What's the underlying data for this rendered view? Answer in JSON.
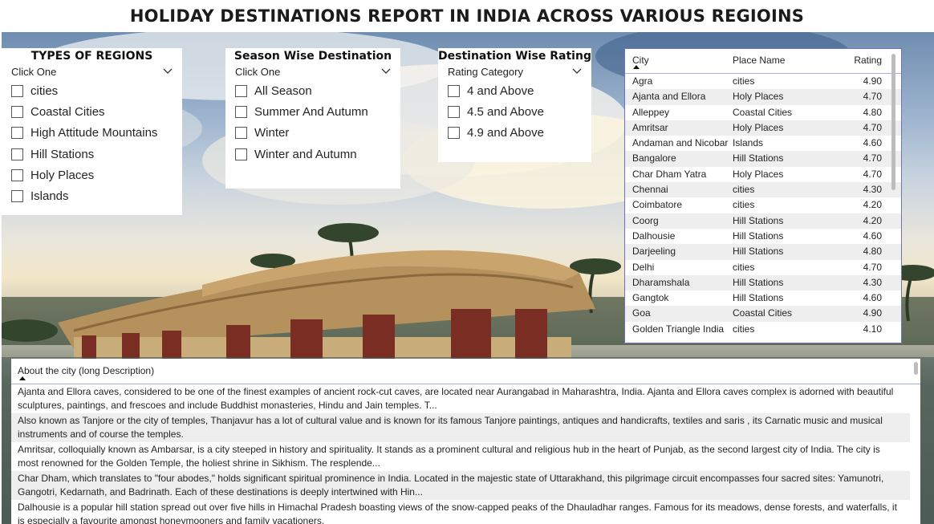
{
  "title": "HOLIDAY DESTINATIONS REPORT IN INDIA ACROSS VARIOUS REGIOINS",
  "regions_slicer": {
    "title": "TYPES OF REGIONS",
    "header": "Click One",
    "items": [
      "cities",
      "Coastal Cities",
      "High Attitude Mountains",
      "Hill Stations",
      "Holy Places",
      "Islands"
    ]
  },
  "season_slicer": {
    "title": "Season Wise Destination",
    "header": "Click One",
    "items": [
      "All Season",
      "Summer And Autumn",
      "Winter",
      "Winter and Autumn"
    ]
  },
  "rating_slicer": {
    "title": "Destination Wise Rating",
    "header": "Rating Category",
    "items": [
      "4 and Above",
      "4.5 and Above",
      "4.9 and Above"
    ]
  },
  "table": {
    "columns": [
      "City",
      "Place Name",
      "Rating"
    ],
    "rows": [
      [
        "Agra",
        "cities",
        "4.90"
      ],
      [
        "Ajanta and Ellora",
        "Holy Places",
        "4.70"
      ],
      [
        "Alleppey",
        "Coastal Cities",
        "4.80"
      ],
      [
        "Amritsar",
        "Holy Places",
        "4.70"
      ],
      [
        "Andaman and Nicobar",
        "Islands",
        "4.60"
      ],
      [
        "Bangalore",
        "Hill Stations",
        "4.70"
      ],
      [
        "Char Dham Yatra",
        "Holy Places",
        "4.70"
      ],
      [
        "Chennai",
        "cities",
        "4.30"
      ],
      [
        "Coimbatore",
        "cities",
        "4.20"
      ],
      [
        "Coorg",
        "Hill Stations",
        "4.20"
      ],
      [
        "Dalhousie",
        "Hill Stations",
        "4.60"
      ],
      [
        "Darjeeling",
        "Hill Stations",
        "4.80"
      ],
      [
        "Delhi",
        "cities",
        "4.70"
      ],
      [
        "Dharamshala",
        "Hill Stations",
        "4.30"
      ],
      [
        "Gangtok",
        "Hill Stations",
        "4.60"
      ],
      [
        "Goa",
        "Coastal Cities",
        "4.90"
      ],
      [
        "Golden Triangle India",
        "cities",
        "4.10"
      ]
    ]
  },
  "description": {
    "header": "About the city (long Description)",
    "rows": [
      "Ajanta and Ellora caves, considered to be one of the finest examples of ancient rock-cut caves, are located near Aurangabad in Maharashtra, India. Ajanta and Ellora caves complex is adorned with beautiful sculptures, paintings, and frescoes and include Buddhist monasteries, Hindu and Jain temples. T...",
      "Also known as Tanjore or the city of temples, Thanjavur has a lot of cultural value and is known for its famous Tanjore paintings, antiques and handicrafts, textiles and saris , its Carnatic music and musical instruments and of course the temples.",
      "Amritsar, colloquially known as Ambarsar, is a city steeped in history and spirituality. It stands as a prominent cultural and religious hub in the heart of Punjab, as the second largest city of India. The city is most renowned for the Golden Temple, the holiest shrine in Sikhism. The resplende...",
      "Char Dham, which translates to \"four abodes,\" holds significant spiritual prominence in India. Located in the majestic state of Uttarakhand, this pilgrimage circuit encompasses four sacred sites: Yamunotri, Gangotri, Kedarnath, and Badrinath. Each of these destinations is deeply intertwined with Hin...",
      "Dalhousie is a popular hill station spread out over five hills in Himachal Pradesh boasting views of the snow-capped peaks of the Dhauladhar ranges. Famous for its meadows, dense forests, and waterfalls, it is especially a favourite amongst honeymooners and family vacationers."
    ]
  }
}
